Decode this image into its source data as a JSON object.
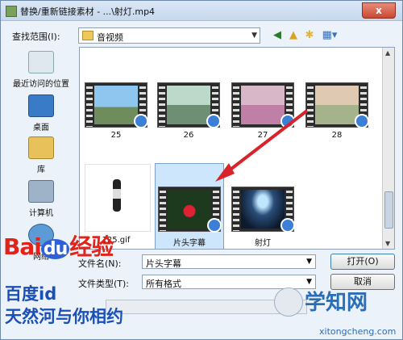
{
  "window": {
    "title": "替换/重新链接素材 - ...\\射灯.mp4",
    "close_label": "x"
  },
  "toolbar": {
    "lookin_label": "查找范围(I):",
    "lookin_value": "音视频"
  },
  "places": [
    {
      "label": "最近访问的位置",
      "icon": "recent-places-icon"
    },
    {
      "label": "桌面",
      "icon": "desktop-icon"
    },
    {
      "label": "库",
      "icon": "libraries-icon"
    },
    {
      "label": "计算机",
      "icon": "computer-icon"
    },
    {
      "label": "网络",
      "icon": "network-icon"
    }
  ],
  "files": [
    {
      "label": "25"
    },
    {
      "label": "26"
    },
    {
      "label": "27"
    },
    {
      "label": "28"
    },
    {
      "label": "125.gif"
    },
    {
      "label": "片头字幕"
    },
    {
      "label": "射灯"
    }
  ],
  "form": {
    "filename_label": "文件名(N):",
    "filename_value": "片头字幕",
    "filetype_label": "文件类型(T):",
    "filetype_value": "所有格式",
    "open_button": "打开(O)",
    "cancel_button": "取消"
  },
  "watermarks": {
    "baidu_logo": "Bai du经验",
    "line1": "百度id",
    "line2": "天然河与你相约",
    "site": "学知网",
    "url": "xitongcheng.com"
  },
  "colors": {
    "arrow": "#d8232a",
    "selection": "#cde6fb"
  }
}
